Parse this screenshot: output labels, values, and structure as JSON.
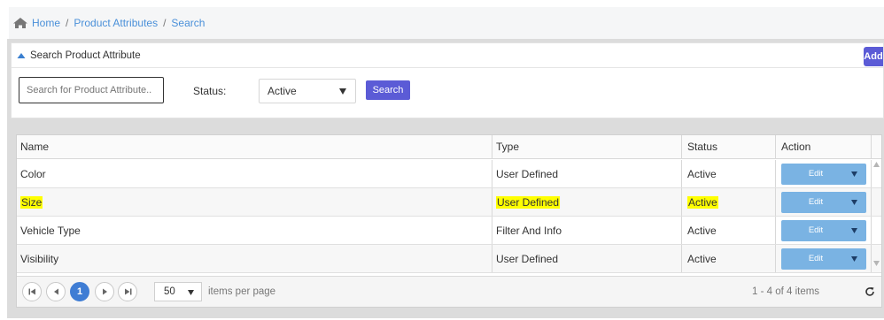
{
  "breadcrumb": {
    "items": [
      "Home",
      "Product Attributes",
      "Search"
    ],
    "separator": "/"
  },
  "search_panel": {
    "title": "Search Product Attribute",
    "add_label": "Add",
    "search_placeholder": "Search for Product Attribute..",
    "status_label": "Status:",
    "status_value": "Active",
    "search_button": "Search"
  },
  "grid": {
    "headers": {
      "name": "Name",
      "type": "Type",
      "status": "Status",
      "action": "Action"
    },
    "rows": [
      {
        "name": "Color",
        "type": "User Defined",
        "status": "Active",
        "action": "Edit",
        "highlighted": false
      },
      {
        "name": "Size",
        "type": "User Defined",
        "status": "Active",
        "action": "Edit",
        "highlighted": true
      },
      {
        "name": "Vehicle Type",
        "type": "Filter And Info",
        "status": "Active",
        "action": "Edit",
        "highlighted": false
      },
      {
        "name": "Visibility",
        "type": "User Defined",
        "status": "Active",
        "action": "Edit",
        "highlighted": false
      }
    ]
  },
  "pager": {
    "current_page": "1",
    "page_size": "50",
    "items_per_page_label": "items per page",
    "info": "1 - 4 of 4 items"
  },
  "colors": {
    "link": "#4a90d9",
    "primary_button": "#5b5bd6",
    "edit_button": "#7ab3e3",
    "highlight": "#ffff00",
    "current_page": "#3f7dd4"
  }
}
